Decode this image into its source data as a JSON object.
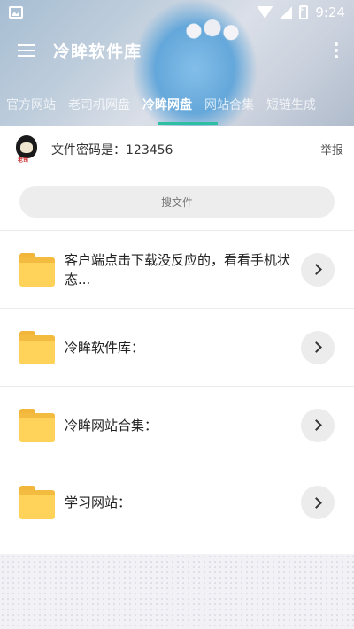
{
  "statusbar": {
    "time": "9:24"
  },
  "app": {
    "title": "冷眸软件库"
  },
  "tabs": [
    {
      "label": "官方网站"
    },
    {
      "label": "老司机网盘"
    },
    {
      "label": "冷眸网盘",
      "active": true
    },
    {
      "label": "网站合集"
    },
    {
      "label": "短链生成"
    }
  ],
  "info": {
    "password_text": "文件密码是：123456",
    "report_label": "举报",
    "avatar_tag": "老司"
  },
  "search": {
    "placeholder": "搜文件"
  },
  "items": [
    {
      "title": "客户端点击下载没反应的，看看手机状态..."
    },
    {
      "title": "冷眸软件库："
    },
    {
      "title": "冷眸网站合集："
    },
    {
      "title": "学习网站："
    }
  ],
  "colors": {
    "accent": "#2ebea2",
    "folder": "#ffd35a"
  }
}
